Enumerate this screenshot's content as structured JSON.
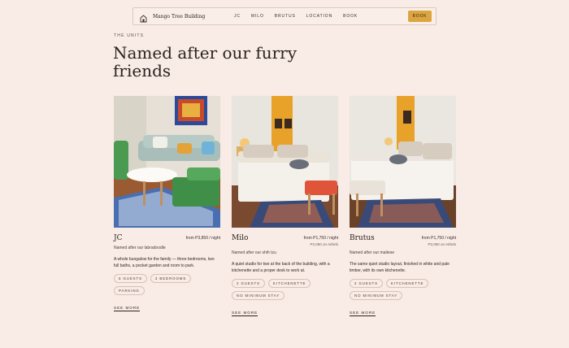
{
  "nav": {
    "brand": "Mango Tree Building",
    "links": [
      "JC",
      "MILO",
      "BRUTUS",
      "LOCATION",
      "BOOK"
    ],
    "cta": "BOOK"
  },
  "section": {
    "eyebrow": "THE UNITS",
    "headline": "Named after our furry friends"
  },
  "units": [
    {
      "name": "JC",
      "price": "from P3,850 / night",
      "price_sub": "",
      "subtitle": "Named after our labradoodle",
      "description": "A whole bungalow for the family — three bedrooms, two full baths, a pocket garden and room to park.",
      "tags": [
        "6 GUESTS",
        "3 BEDROOMS",
        "PARKING"
      ],
      "cta": "SEE MORE"
    },
    {
      "name": "Milo",
      "price": "from P1,750 / night",
      "price_sub": "P2,050 on Airbnb",
      "subtitle": "Named after our shih tzu",
      "description": "A quiet studio for two at the back of the building, with a kitchenette and a proper desk to work at.",
      "tags": [
        "2 GUESTS",
        "KITCHENETTE",
        "NO MINIMUM STAY"
      ],
      "cta": "SEE MORE"
    },
    {
      "name": "Brutus",
      "price": "from P1,750 / night",
      "price_sub": "P2,050 on Airbnb",
      "subtitle": "Named after our maltese",
      "description": "The same quiet studio layout, finished in white and pale timber, with its own kitchenette.",
      "tags": [
        "2 GUESTS",
        "KITCHENETTE",
        "NO MINIMUM STAY"
      ],
      "cta": "SEE MORE"
    }
  ],
  "colors": {
    "background": "#f9ebe5",
    "accent": "#dca540",
    "text": "#2a2420"
  }
}
